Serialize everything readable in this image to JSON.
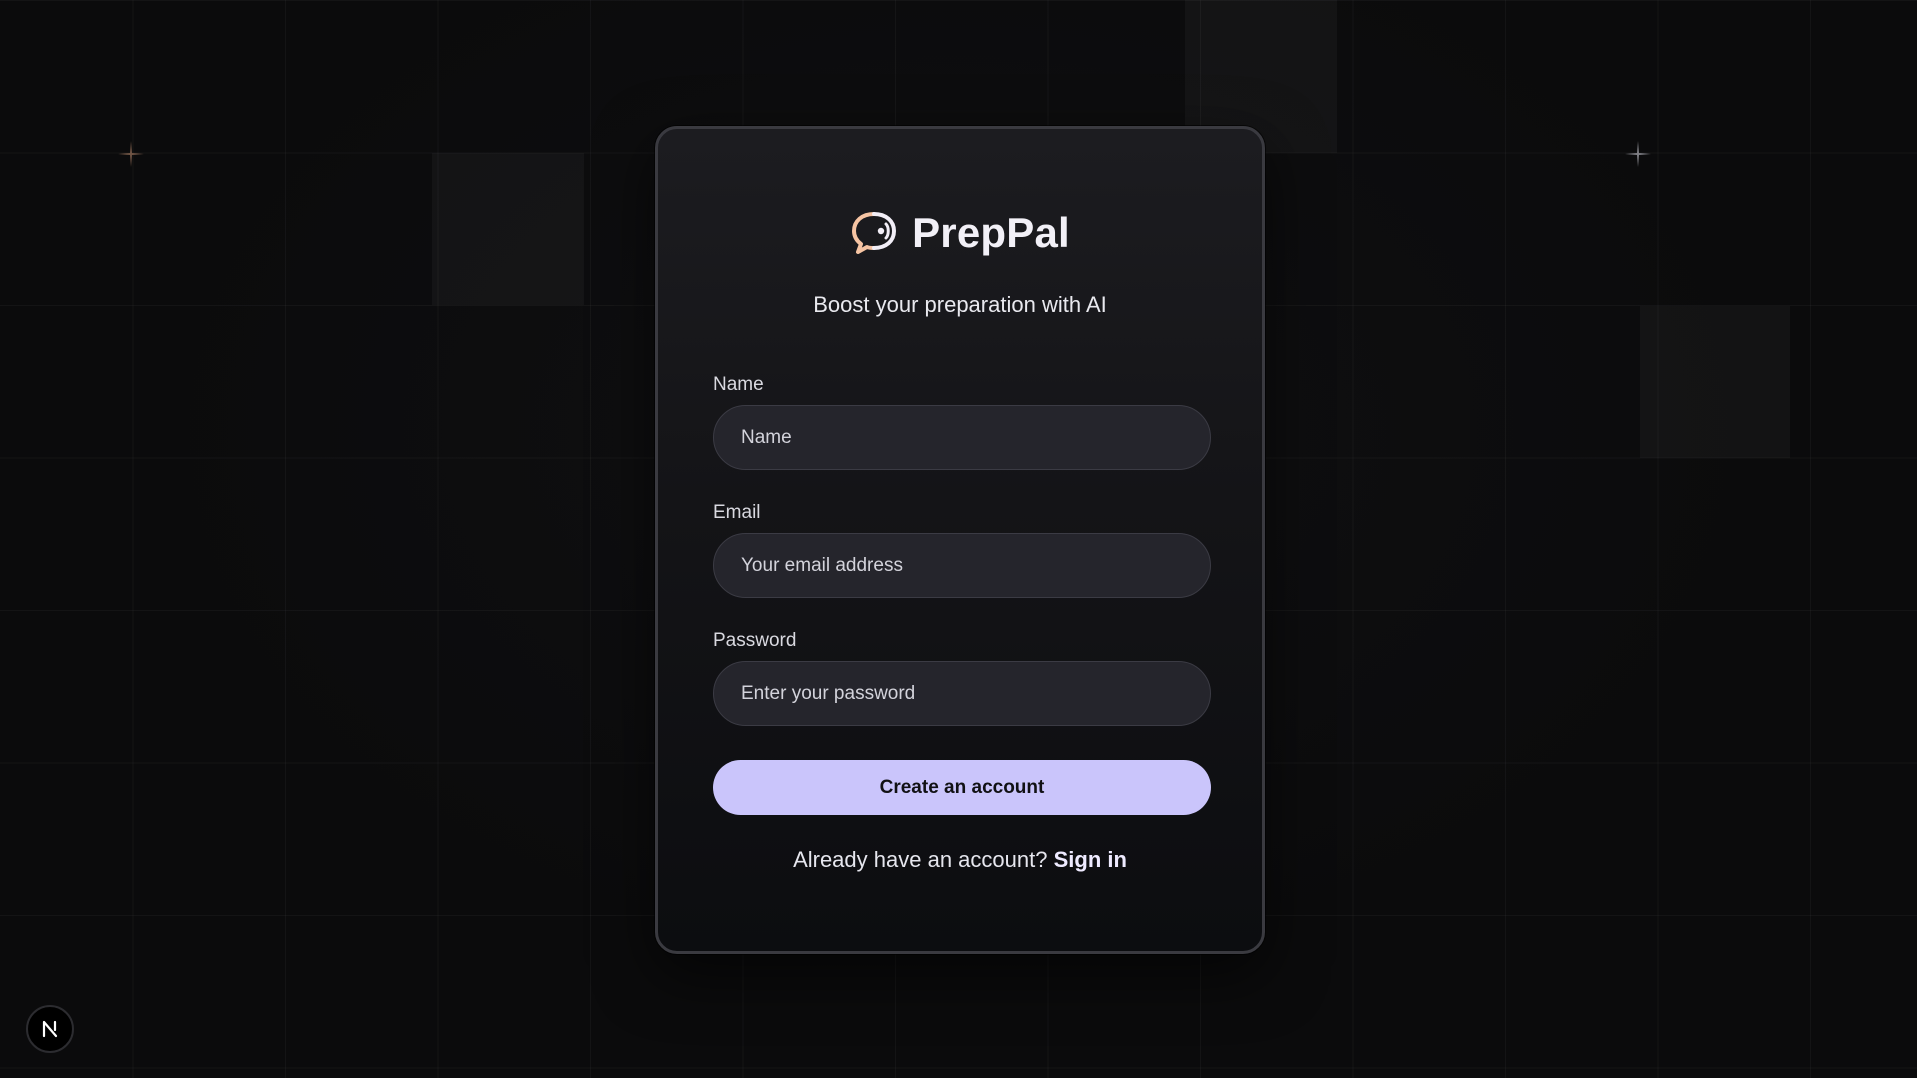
{
  "brand": {
    "name": "PrepPal",
    "tagline": "Boost your preparation with AI",
    "logo_icon": "chat-bubble-broadcast-icon"
  },
  "form": {
    "name": {
      "label": "Name",
      "placeholder": "Name",
      "value": ""
    },
    "email": {
      "label": "Email",
      "placeholder": "Your email address",
      "value": ""
    },
    "password": {
      "label": "Password",
      "placeholder": "Enter your password",
      "value": ""
    },
    "submit_label": "Create an account"
  },
  "signin": {
    "prompt": "Already have an account?",
    "link_label": "Sign in"
  },
  "dev_badge": {
    "icon": "nextjs-n-icon"
  },
  "colors": {
    "background": "#0b0b0c",
    "card_border": "#3a3a40",
    "input_background": "#25252c",
    "button_accent": "#cac5fb",
    "logo_accent": "#f6c4a3"
  }
}
